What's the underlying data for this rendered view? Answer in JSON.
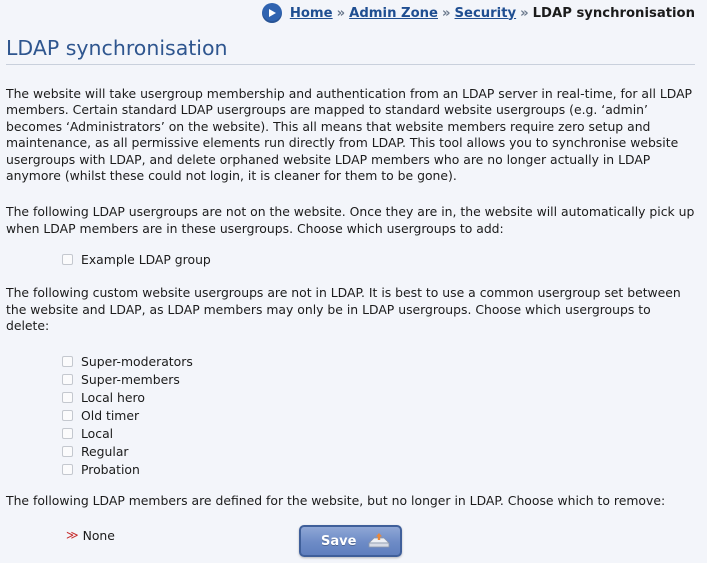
{
  "breadcrumb": {
    "icon": "circle-arrow-right-icon",
    "items": [
      "Home",
      "Admin Zone",
      "Security"
    ],
    "separator": "»",
    "current": "LDAP synchronisation"
  },
  "page": {
    "title": "LDAP synchronisation",
    "intro": "The website will take usergroup membership and authentication from an LDAP server in real-time, for all LDAP members. Certain standard LDAP usergroups are mapped to standard website usergroups (e.g. ‘admin’ becomes ‘Administrators’ on the website). This all means that website members require zero setup and maintenance, as all permissive elements run directly from LDAP. This tool allows you to synchronise website usergroups with LDAP, and delete orphaned website LDAP members who are no longer actually in LDAP anymore (whilst these could not login, it is cleaner for them to be gone).",
    "add_text": "The following LDAP usergroups are not on the website. Once they are in, the website will automatically pick up when LDAP members are in these usergroups. Choose which usergroups to add:",
    "add_groups": [
      "Example LDAP group"
    ],
    "delete_text": "The following custom website usergroups are not in LDAP. It is best to use a common usergroup set between the website and LDAP, as LDAP members may only be in LDAP usergroups. Choose which usergroups to delete:",
    "delete_groups": [
      "Super-moderators",
      "Super-members",
      "Local hero",
      "Old timer",
      "Local",
      "Regular",
      "Probation"
    ],
    "remove_text": "The following LDAP members are defined for the website, but no longer in LDAP. Choose which to remove:",
    "remove_none": "None",
    "remove_marker_icon": "double-chevron-right-icon"
  },
  "actions": {
    "save_label": "Save",
    "save_icon": "save-tray-icon"
  },
  "colors": {
    "title": "#2f568f",
    "link": "#1f4e91",
    "button": "#6d8bc6",
    "marker": "#c62d2d"
  }
}
